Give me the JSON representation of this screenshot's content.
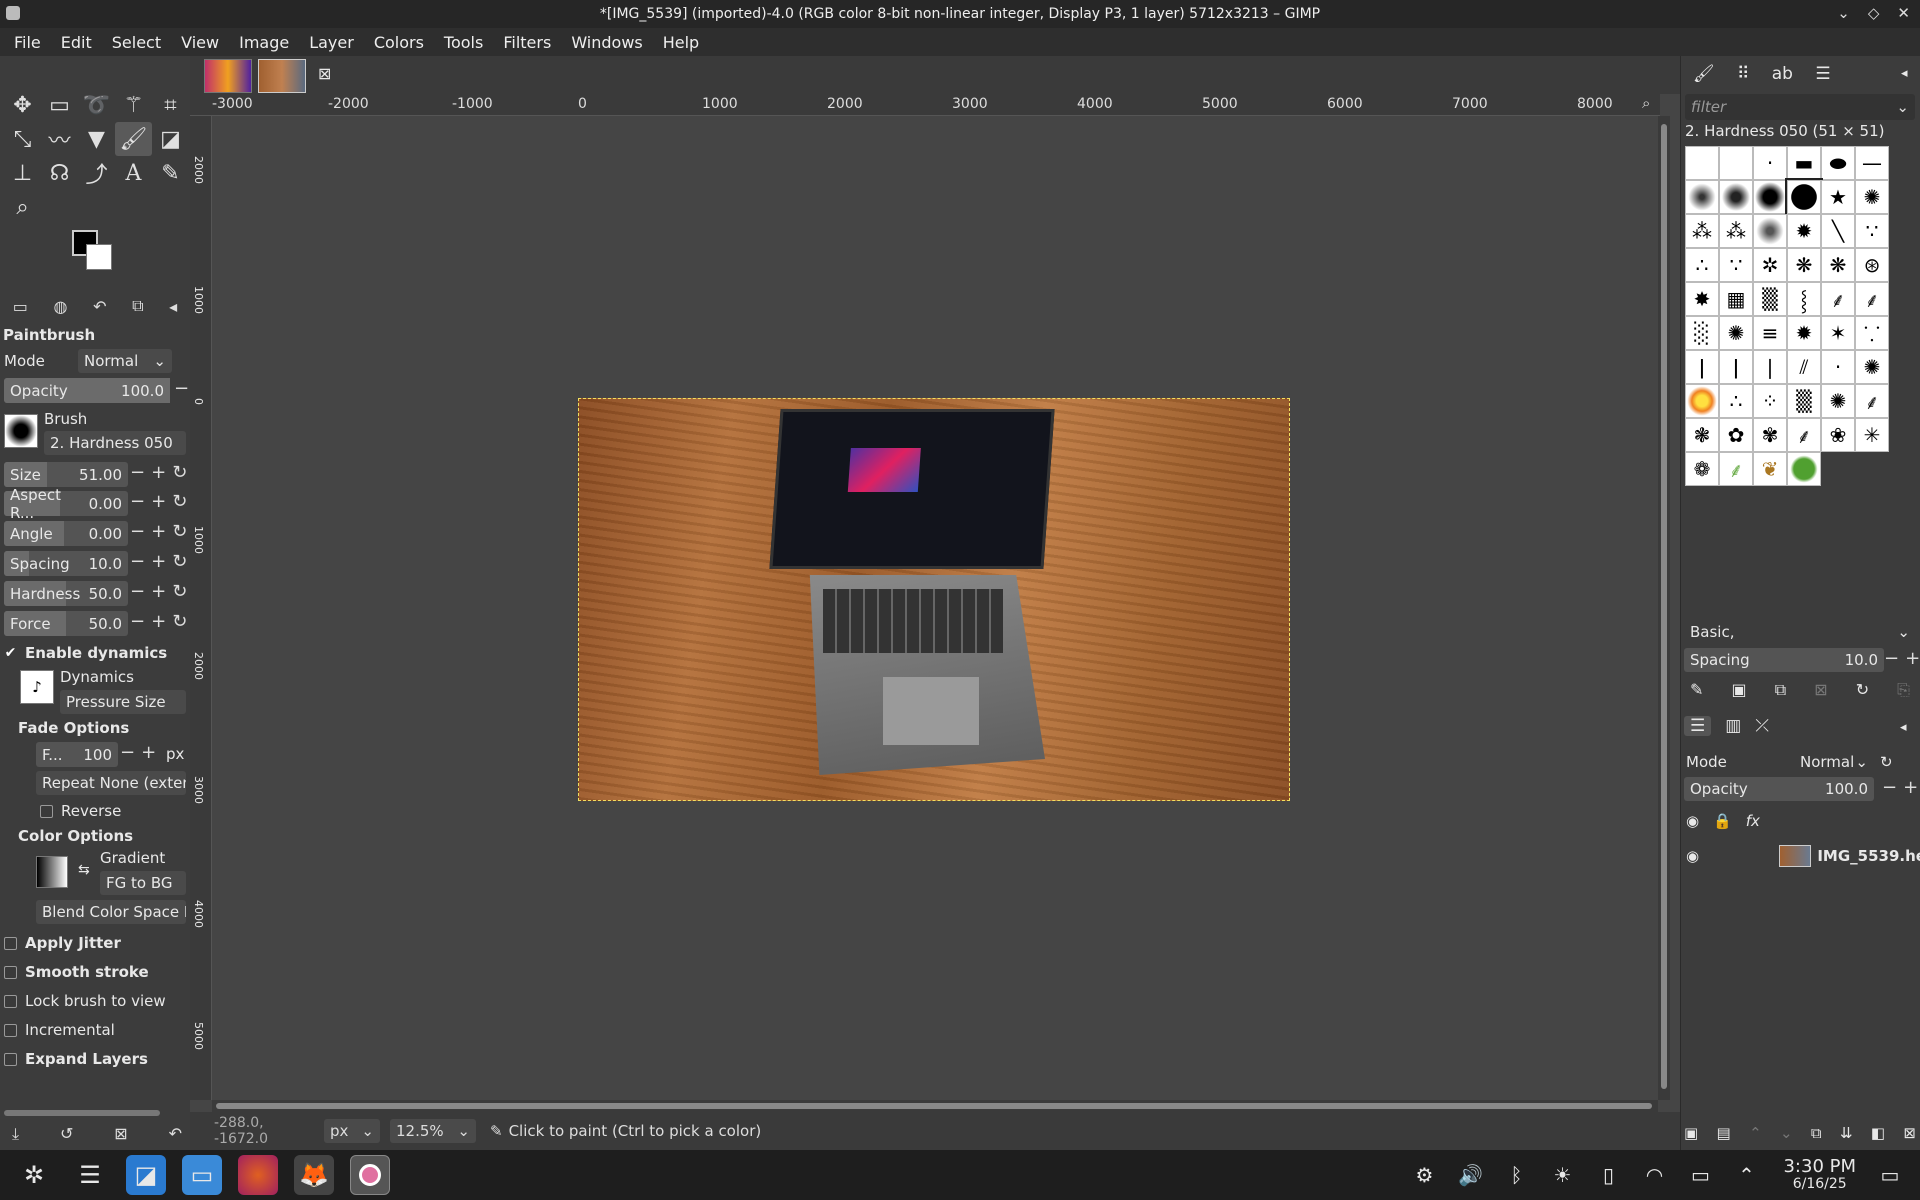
{
  "window": {
    "title": "*[IMG_5539] (imported)-4.0 (RGB color 8-bit non-linear integer, Display P3, 1 layer) 5712x3213 – GIMP"
  },
  "menu": [
    "File",
    "Edit",
    "Select",
    "View",
    "Image",
    "Layer",
    "Colors",
    "Tools",
    "Filters",
    "Windows",
    "Help"
  ],
  "tool_options": {
    "title": "Paintbrush",
    "mode_label": "Mode",
    "mode_value": "Normal",
    "opacity_label": "Opacity",
    "opacity_value": "100.0",
    "brush_label": "Brush",
    "brush_value": "2. Hardness 050",
    "size_label": "Size",
    "size_value": "51.00",
    "aspect_label": "Aspect R...",
    "aspect_value": "0.00",
    "angle_label": "Angle",
    "angle_value": "0.00",
    "spacing_label": "Spacing",
    "spacing_value": "10.0",
    "hardness_label": "Hardness",
    "hardness_value": "50.0",
    "force_label": "Force",
    "force_value": "50.0",
    "enable_dynamics": "Enable dynamics",
    "dynamics_label": "Dynamics",
    "dynamics_value": "Pressure Size",
    "fade_options": "Fade Options",
    "fade_label": "F...",
    "fade_value": "100",
    "fade_unit": "px",
    "repeat_label": "Repeat",
    "repeat_value": "None (extend",
    "reverse": "Reverse",
    "color_options": "Color Options",
    "gradient_label": "Gradient",
    "gradient_value": "FG to BG",
    "blend_color_space": "Blend Color Space P...",
    "apply_jitter": "Apply Jitter",
    "smooth_stroke": "Smooth stroke",
    "lock_brush": "Lock brush to view",
    "incremental": "Incremental",
    "expand_layers": "Expand Layers"
  },
  "ruler_top": [
    "-3000",
    "-2000",
    "-1000",
    "0",
    "1000",
    "2000",
    "3000",
    "4000",
    "5000",
    "6000",
    "7000",
    "8000"
  ],
  "ruler_left": [
    "2000",
    "1000",
    "0",
    "1000",
    "2000",
    "3000",
    "4000",
    "5000"
  ],
  "status": {
    "coords": "-288.0, -1672.0",
    "unit": "px",
    "zoom": "12.5%",
    "message": "Click to paint (Ctrl to pick a color)"
  },
  "brushes": {
    "filter_placeholder": "filter",
    "selected": "2. Hardness 050 (51 × 51)",
    "tag": "Basic,",
    "spacing_label": "Spacing",
    "spacing_value": "10.0"
  },
  "layers": {
    "mode_label": "Mode",
    "mode_value": "Normal",
    "opacity_label": "Opacity",
    "opacity_value": "100.0",
    "fx": "fx",
    "layer_name": "IMG_5539.he"
  },
  "taskbar": {
    "time": "3:30 PM",
    "date": "6/16/25"
  }
}
